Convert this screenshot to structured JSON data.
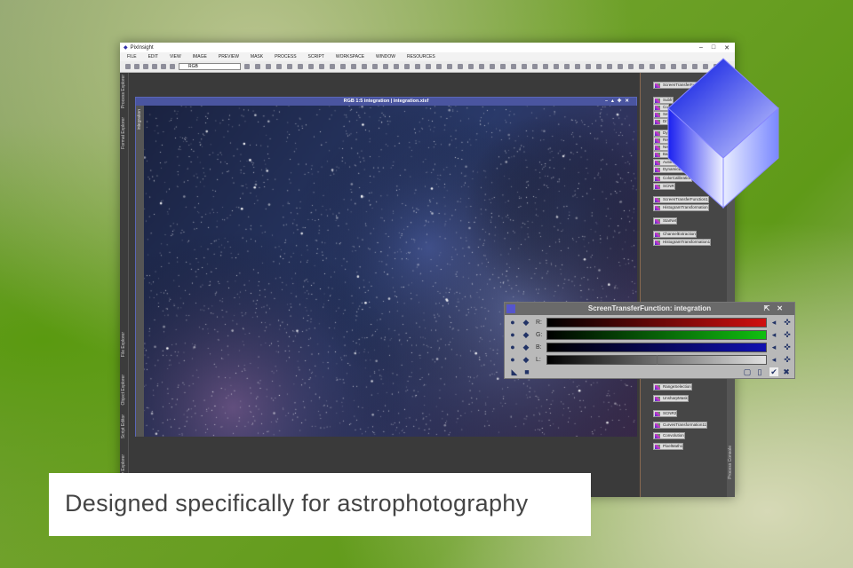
{
  "app": {
    "title": "PixInsight"
  },
  "menu": [
    "FILE",
    "EDIT",
    "VIEW",
    "IMAGE",
    "PREVIEW",
    "MASK",
    "PROCESS",
    "SCRIPT",
    "WORKSPACE",
    "WINDOW",
    "RESOURCES"
  ],
  "toolbar": {
    "channel_select": "RGB"
  },
  "left_tabs": [
    "Process Explorer",
    "Format Explorer",
    "File Explorer",
    "Object Explorer",
    "Script Editor",
    "History Explorer"
  ],
  "image_window": {
    "title": "RGB 1:5 integration | integration.xisf",
    "tab": "integration"
  },
  "process_icons": [
    "ScreenTransferFunction",
    "Subfr",
    "Co",
    "Se",
    "Dr",
    "Dy",
    "Rela",
    "NeiRelation",
    "BackgroundNeut",
    "AutomaticBackgroundE",
    "DynamicBackgroundExtraction",
    "ColorCalibration",
    "SCNR",
    "ScreenTransferFunction1",
    "HistogramTransformation",
    "StarNet",
    "ChannelExtraction",
    "HistogramTransformation1",
    "RangeSelection",
    "UnsharpMask",
    "SCNR2",
    "CurvesTransformation11",
    "Convolution",
    "PixelMath1"
  ],
  "right_tab": "Process Console",
  "stf": {
    "title": "ScreenTransferFunction: integration",
    "channels": [
      {
        "label": "R:",
        "color": "#d01010"
      },
      {
        "label": "G:",
        "color": "#10c010"
      },
      {
        "label": "B:",
        "color": "#1010b0"
      },
      {
        "label": "L:",
        "color": "#e0e0e0"
      }
    ],
    "l_midtone": 0.5
  },
  "caption": "Designed specifically for astrophotography"
}
